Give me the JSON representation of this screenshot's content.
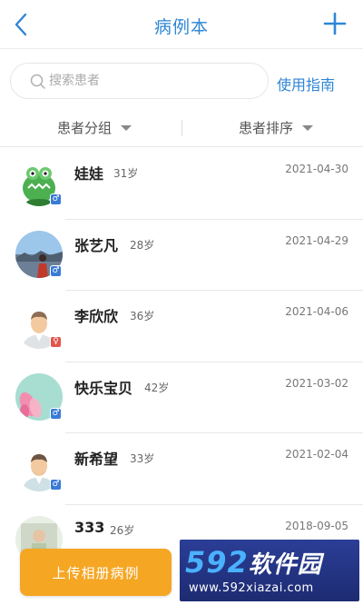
{
  "header": {
    "title": "病例本",
    "back_icon": "chevron-left-icon",
    "add_icon": "plus-icon",
    "accent_color": "#2f86d6"
  },
  "search": {
    "placeholder": "搜索患者",
    "guide_label": "使用指南"
  },
  "filters": {
    "group_label": "患者分组",
    "sort_label": "患者排序"
  },
  "patients": [
    {
      "name": "娃娃",
      "age": "31岁",
      "date": "2021-04-30",
      "gender": "male",
      "gender_glyph": "♂",
      "avatar": "green-monster-avatar"
    },
    {
      "name": "张艺凡",
      "age": "28岁",
      "date": "2021-04-29",
      "gender": "male",
      "gender_glyph": "♂",
      "avatar": "landscape-photo-avatar"
    },
    {
      "name": "李欣欣",
      "age": "36岁",
      "date": "2021-04-06",
      "gender": "female",
      "gender_glyph": "♀",
      "avatar": "default-person-avatar"
    },
    {
      "name": "快乐宝贝",
      "age": "42岁",
      "date": "2021-03-02",
      "gender": "male",
      "gender_glyph": "♂",
      "avatar": "pink-flowers-avatar"
    },
    {
      "name": "新希望",
      "age": "33岁",
      "date": "2021-02-04",
      "gender": "male",
      "gender_glyph": "♂",
      "avatar": "default-person-avatar"
    },
    {
      "name": "333",
      "age": "26岁",
      "date": "2018-09-05",
      "gender": "male",
      "gender_glyph": "♂",
      "avatar": "child-photo-avatar"
    }
  ],
  "upload_button": "上传相册病例",
  "watermark": {
    "digits": "592",
    "text": "软件园",
    "url": "www.592xiazai.com"
  },
  "colors": {
    "upload_button": "#f5a623",
    "male_badge": "#3a7bd5",
    "female_badge": "#e2554b"
  }
}
